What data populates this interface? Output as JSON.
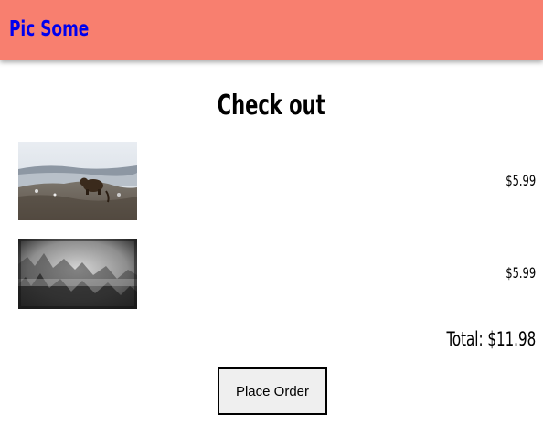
{
  "header": {
    "brand": "Pic Some",
    "background": "#f87f6f",
    "brand_color": "#0000ee"
  },
  "page": {
    "title": "Check out"
  },
  "cart": {
    "items": [
      {
        "image": "bear-on-rocky-hillside-photo",
        "price": "$5.99"
      },
      {
        "image": "misty-forest-black-and-white-photo",
        "price": "$5.99"
      }
    ],
    "total": "Total: $11.98"
  },
  "actions": {
    "place_order": "Place Order"
  }
}
